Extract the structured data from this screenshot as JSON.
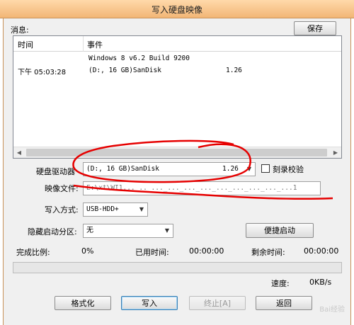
{
  "window": {
    "title": "写入硬盘映像"
  },
  "messages": {
    "label": "消息:",
    "save_button": "保存",
    "columns": {
      "time": "时间",
      "event": "事件"
    },
    "rows": [
      {
        "time": "",
        "event": "Windows 8 v6.2 Build 9200",
        "extra": ""
      },
      {
        "time": "下午 05:03:28",
        "event": "(D:, 16 GB)SanDisk",
        "extra": "1.26"
      }
    ]
  },
  "drive": {
    "label": "硬盘驱动器",
    "value": "(D:, 16 GB)SanDisk",
    "version": "1.26",
    "verify_label": "刻录校验"
  },
  "image": {
    "label": "映像文件:",
    "value": "E:\\xt\\WI1..._.._..._..._..._..._..._..._..._..._...1"
  },
  "write_mode": {
    "label": "写入方式:",
    "value": "USB-HDD+"
  },
  "hidden_partition": {
    "label": "隐藏启动分区:",
    "value": "无",
    "boot_button": "便捷启动"
  },
  "status": {
    "complete_label": "完成比例:",
    "complete_value": "0%",
    "elapsed_label": "已用时间:",
    "elapsed_value": "00:00:00",
    "remaining_label": "剩余时间:",
    "remaining_value": "00:00:00",
    "speed_label": "速度:",
    "speed_value": "0KB/s",
    "progress": 0
  },
  "buttons": {
    "format": "格式化",
    "write": "写入",
    "stop": "终止[A]",
    "back": "返回"
  },
  "colors": {
    "annotation": "#e60000",
    "titlebar": "#f2b676"
  }
}
